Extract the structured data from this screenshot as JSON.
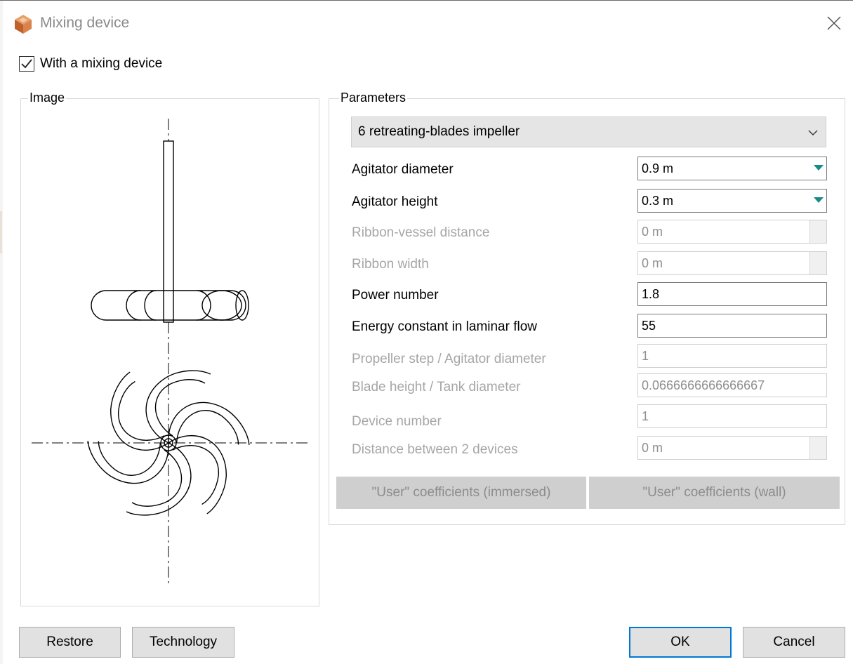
{
  "window": {
    "title": "Mixing device"
  },
  "with_device": {
    "label": "With a mixing device",
    "checked": true
  },
  "image_group": {
    "legend": "Image"
  },
  "parameters": {
    "legend": "Parameters",
    "impeller_type": "6 retreating-blades impeller",
    "rows": [
      {
        "label": "Agitator diameter",
        "value": "0.9 m",
        "enabled": true,
        "dropdown": true
      },
      {
        "label": "Agitator height",
        "value": "0.3 m",
        "enabled": true,
        "dropdown": true
      },
      {
        "label": "Ribbon-vessel distance",
        "value": "0 m",
        "enabled": false
      },
      {
        "label": "Ribbon width",
        "value": "0 m",
        "enabled": false
      },
      {
        "label": "Power number",
        "value": "1.8",
        "enabled": true
      },
      {
        "label": "Energy constant in laminar flow",
        "value": "55",
        "enabled": true
      },
      {
        "label": "Propeller step / Agitator diameter",
        "value": "1",
        "enabled": false
      },
      {
        "label": "Blade height / Tank diameter",
        "value": "0.0666666666666667",
        "enabled": false
      },
      {
        "label": "Device number",
        "value": "1",
        "enabled": false
      },
      {
        "label": "Distance between 2 devices",
        "value": "0 m",
        "enabled": false
      }
    ],
    "user_coeff_immersed": "\"User\" coefficients (immersed)",
    "user_coeff_wall": "\"User\" coefficients (wall)"
  },
  "footer": {
    "restore": "Restore",
    "technology": "Technology",
    "ok": "OK",
    "cancel": "Cancel"
  },
  "colors": {
    "accent": "#0078d7",
    "dropdown_arrow": "#168b8b",
    "disabled_text": "#a6a6a6",
    "icon_orange": "#d9824b"
  }
}
